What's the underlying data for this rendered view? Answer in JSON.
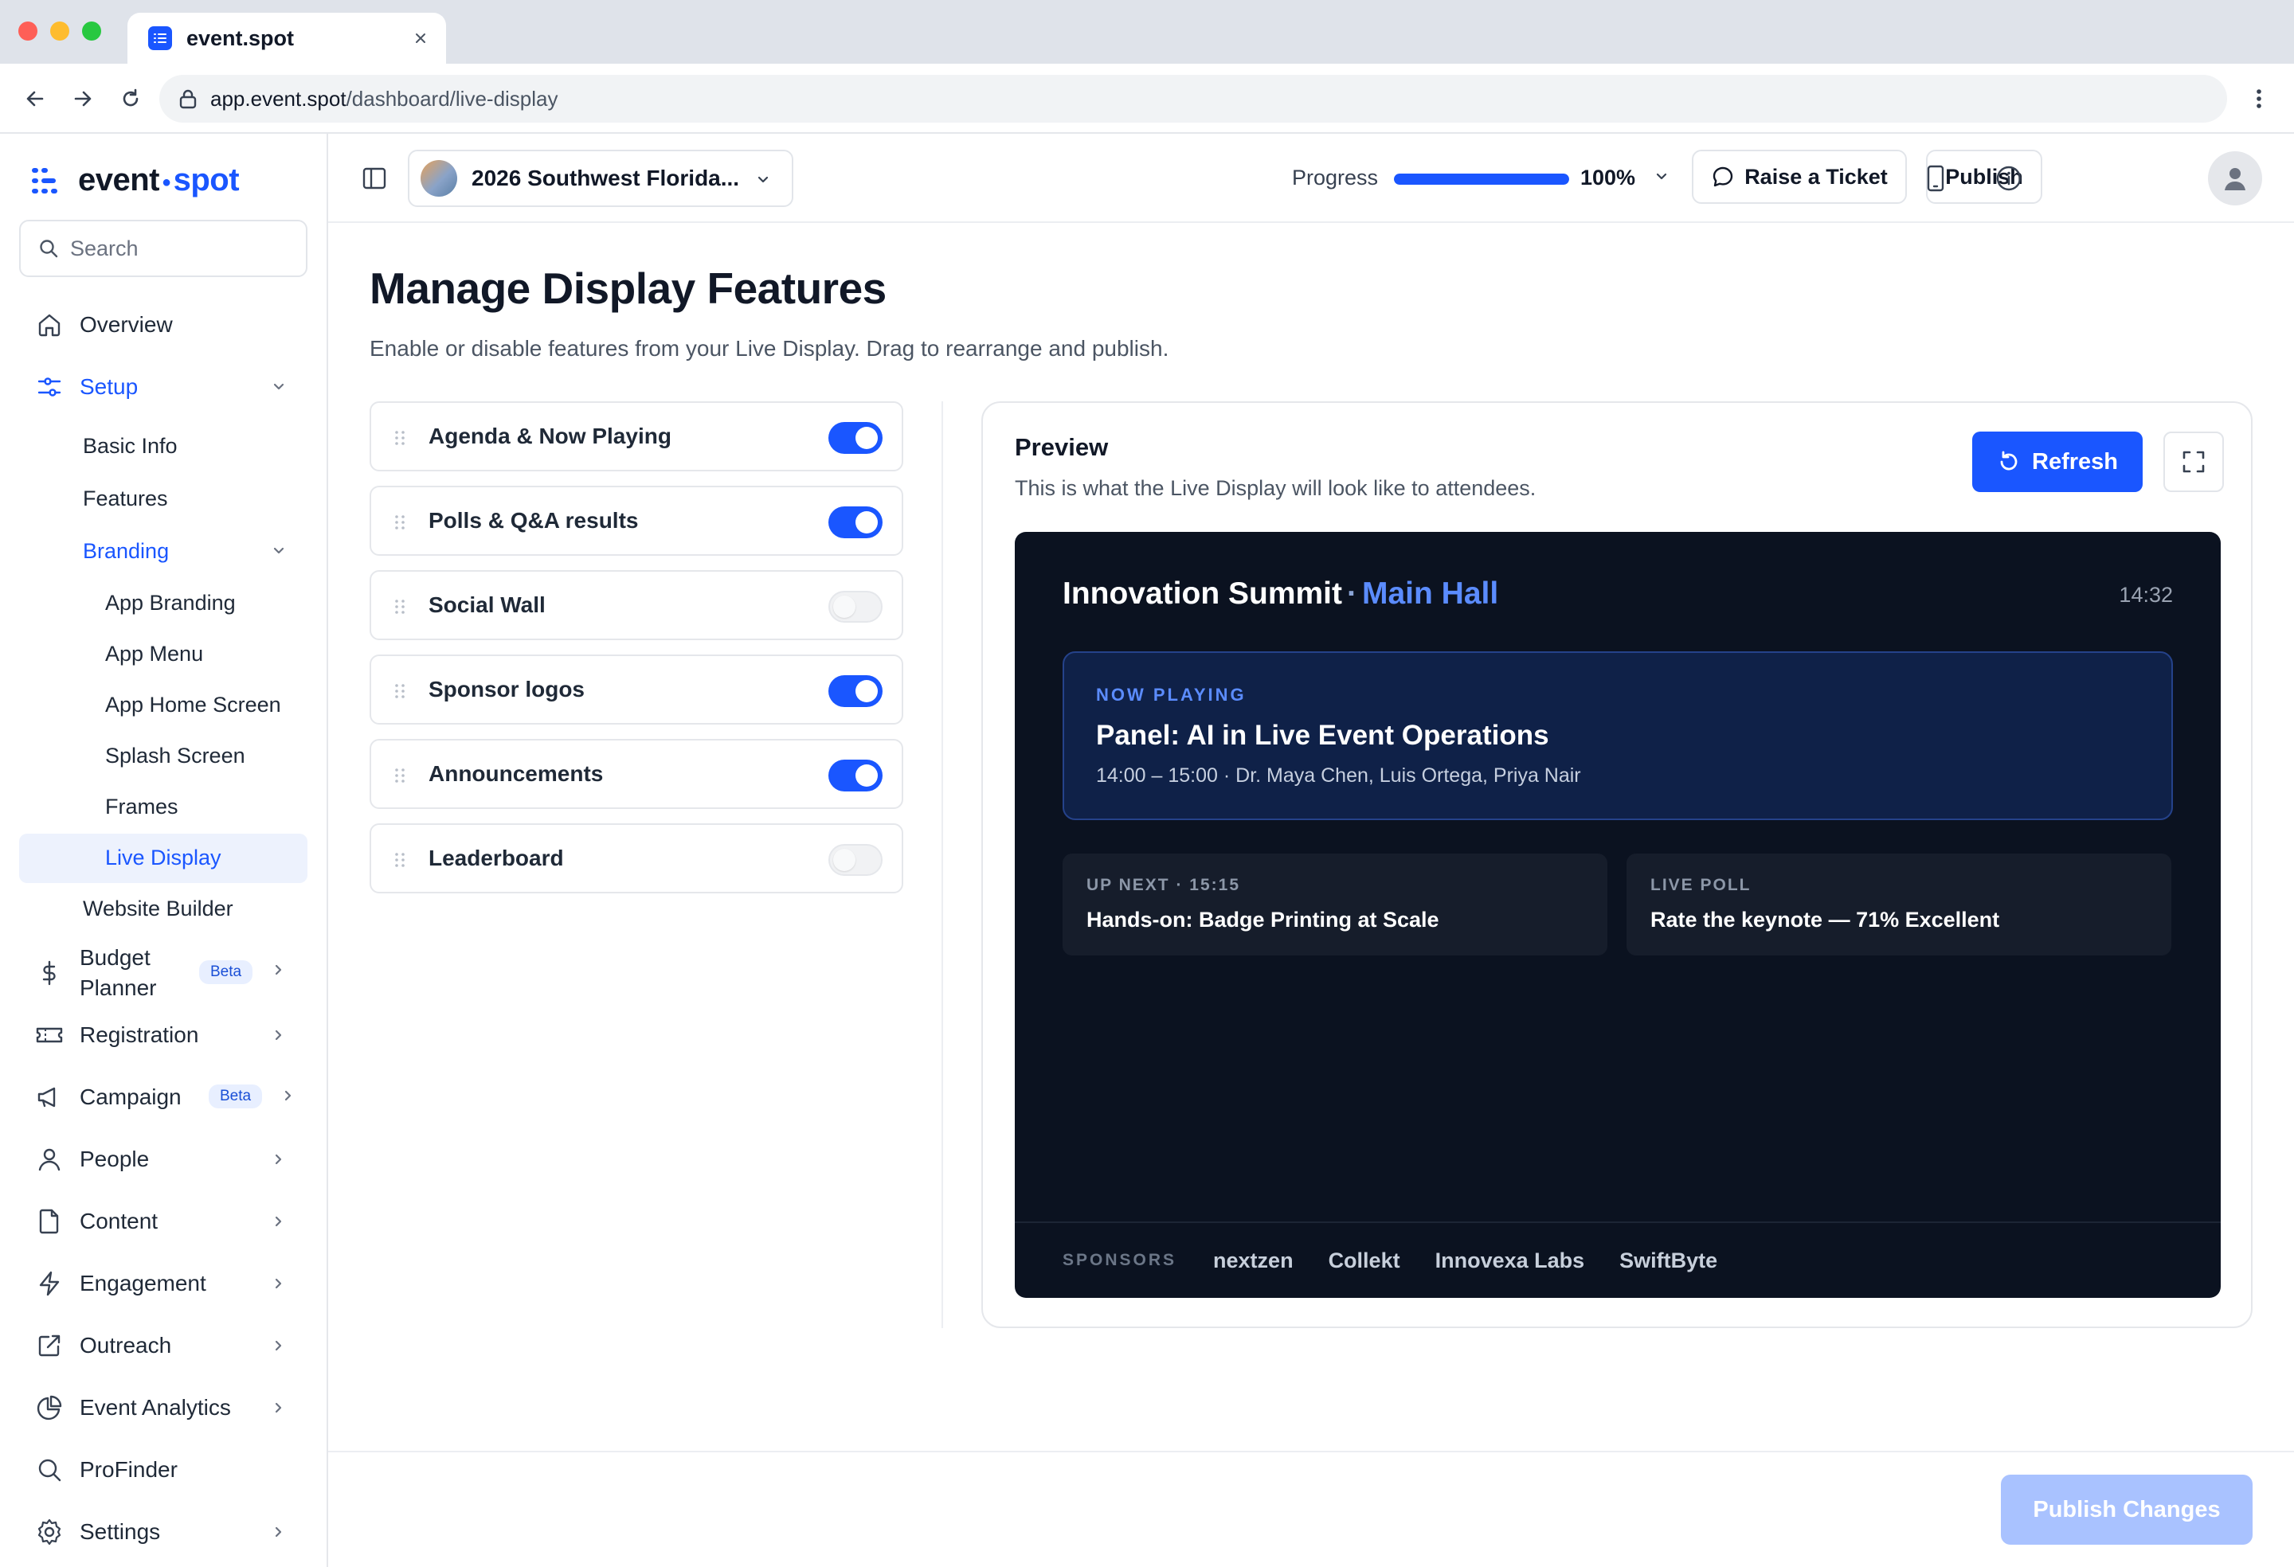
{
  "browser": {
    "tab_title": "event.spot",
    "url_host": "app.event.spot",
    "url_path": "/dashboard/live-display"
  },
  "sidebar": {
    "logo_event": "event",
    "logo_spot": "spot",
    "search_placeholder": "Search",
    "nav": {
      "overview": "Overview",
      "setup": "Setup",
      "basic_info": "Basic Info",
      "features": "Features",
      "branding": "Branding",
      "app_branding": "App Branding",
      "app_menu": "App Menu",
      "app_home_screen": "App Home Screen",
      "splash_screen": "Splash Screen",
      "frames": "Frames",
      "live_display": "Live Display",
      "website_builder": "Website Builder",
      "budget_planner_1": "Budget",
      "budget_planner_2": "Planner",
      "registration": "Registration",
      "campaign": "Campaign",
      "people": "People",
      "content": "Content",
      "engagement": "Engagement",
      "outreach": "Outreach",
      "event_analytics": "Event Analytics",
      "profinder": "ProFinder",
      "settings": "Settings"
    },
    "beta_label": "Beta"
  },
  "header": {
    "event_name": "2026 Southwest Florida...",
    "progress_label": "Progress",
    "progress_value": 1.0,
    "progress_pct": "100%",
    "raise_ticket": "Raise a Ticket",
    "publish": "Publish"
  },
  "main": {
    "title": "Manage Display Features",
    "subtitle": "Enable or disable features from your Live Display. Drag to rearrange and publish.",
    "features": [
      {
        "label": "Agenda & Now Playing",
        "enabled": true
      },
      {
        "label": "Polls & Q&A results",
        "enabled": true
      },
      {
        "label": "Social Wall",
        "enabled": false
      },
      {
        "label": "Sponsor logos",
        "enabled": true
      },
      {
        "label": "Announcements",
        "enabled": true
      },
      {
        "label": "Leaderboard",
        "enabled": false
      }
    ],
    "preview": {
      "title": "Preview",
      "subtitle": "This is what the Live Display will look like to attendees.",
      "refresh": "Refresh"
    },
    "display": {
      "event": "Innovation Summit",
      "separator": "·",
      "hall": "Main Hall",
      "clock": "14:32",
      "now_tag": "NOW PLAYING",
      "now_title": "Panel: AI in Live Event Operations",
      "now_meta": "14:00 – 15:00 · Dr. Maya Chen, Luis Ortega, Priya Nair",
      "up_next_tag": "UP NEXT · 15:15",
      "up_next_text": "Hands-on: Badge Printing at Scale",
      "poll_tag": "LIVE POLL",
      "poll_text": "Rate the keynote — 71% Excellent",
      "sponsors_tag": "SPONSORS",
      "sponsors": [
        "nextzen",
        "Collekt",
        "Innovexa Labs",
        "SwiftByte"
      ]
    },
    "publish_changes": "Publish Changes"
  },
  "colors": {
    "accent": "#1a56ff",
    "display_bg": "#0b1220",
    "now_box_bg": "#0f2148",
    "hall_text": "#5b8cff",
    "publish_changes_disabled": "#a9c2ff"
  }
}
